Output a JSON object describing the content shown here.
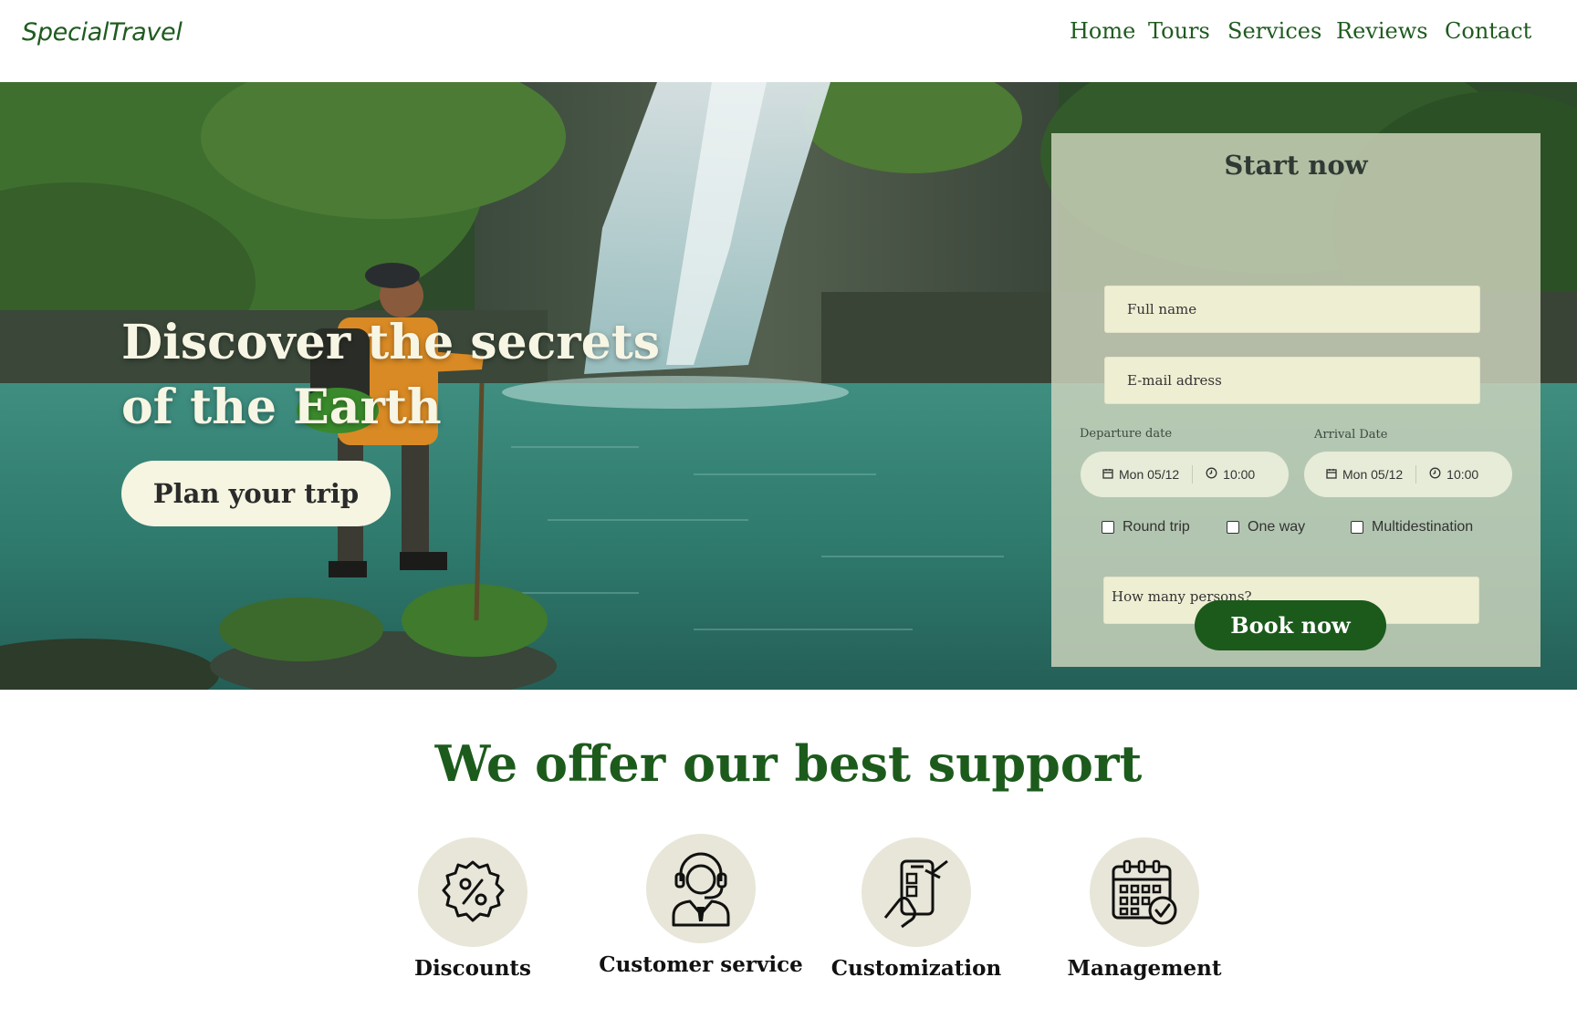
{
  "header": {
    "logo": "SpecialTravel",
    "nav": [
      "Home",
      "Tours",
      "Services",
      "Reviews",
      "Contact"
    ]
  },
  "hero": {
    "title_line1": "Discover the secrets",
    "title_line2": "of the Earth",
    "cta": "Plan your trip"
  },
  "booking": {
    "title": "Start now",
    "full_name_placeholder": "Full name",
    "email_placeholder": "E-mail adress",
    "departure_label": "Departure date",
    "arrival_label": "Arrival Date",
    "departure_date": "Mon 05/12",
    "departure_time": "10:00",
    "arrival_date": "Mon 05/12",
    "arrival_time": "10:00",
    "options": [
      "Round trip",
      "One way",
      "Multidestination"
    ],
    "persons_placeholder": "How many persons?",
    "submit": "Book now"
  },
  "support": {
    "title": "We offer our best support",
    "features": [
      {
        "label": "Discounts",
        "icon": "discount-badge-icon"
      },
      {
        "label": "Customer service",
        "icon": "headset-agent-icon"
      },
      {
        "label": "Customization",
        "icon": "mobile-edit-icon"
      },
      {
        "label": "Management",
        "icon": "calendar-check-icon"
      }
    ]
  },
  "colors": {
    "brand_green": "#1f5b1f",
    "cream": "#f6f5e1",
    "icon_bg": "#e8e6d8"
  }
}
